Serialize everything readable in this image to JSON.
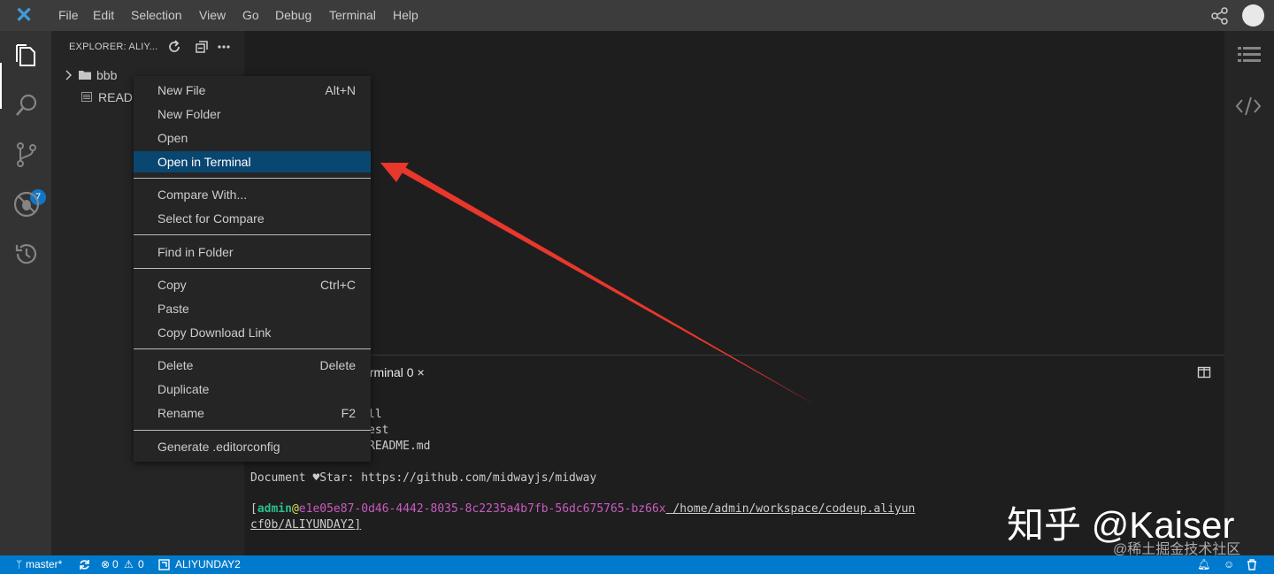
{
  "titlebar": {
    "menu": [
      "File",
      "Edit",
      "Selection",
      "View",
      "Go",
      "Debug",
      "Terminal",
      "Help"
    ]
  },
  "activitybar": {
    "icons": [
      "files-icon",
      "search-icon",
      "source-control-icon",
      "debug-icon",
      "history-icon"
    ],
    "scm_badge": "7"
  },
  "explorer": {
    "title": "EXPLORER: ALIY...",
    "items": [
      {
        "label": "bbb",
        "icon": "folder-icon"
      },
      {
        "label": "READM",
        "icon": "markdown-file-icon"
      }
    ]
  },
  "context_menu": {
    "groups": [
      [
        {
          "label": "New File",
          "shortcut": "Alt+N"
        },
        {
          "label": "New Folder",
          "shortcut": ""
        },
        {
          "label": "Open",
          "shortcut": ""
        },
        {
          "label": "Open in Terminal",
          "shortcut": "",
          "highlighted": true
        }
      ],
      [
        {
          "label": "Compare With...",
          "shortcut": ""
        },
        {
          "label": "Select for Compare",
          "shortcut": ""
        }
      ],
      [
        {
          "label": "Find in Folder",
          "shortcut": ""
        }
      ],
      [
        {
          "label": "Copy",
          "shortcut": "Ctrl+C"
        },
        {
          "label": "Paste",
          "shortcut": ""
        },
        {
          "label": "Copy Download Link",
          "shortcut": ""
        }
      ],
      [
        {
          "label": "Delete",
          "shortcut": "Delete"
        },
        {
          "label": "Duplicate",
          "shortcut": ""
        },
        {
          "label": "Rename",
          "shortcut": "F2"
        }
      ],
      [
        {
          "label": "Generate .editorconfig",
          "shortcut": ""
        }
      ]
    ]
  },
  "panel": {
    "tab": "erminal 0 ×",
    "lines": {
      "l1": "ll",
      "l2": "est",
      "l3": "README.md",
      "l4": "Document ♥Star: https://github.com/midwayjs/midway",
      "prompt_bracket_open": "[",
      "prompt_user": "admin",
      "prompt_at": "@",
      "prompt_host": "e1e05e87-0d46-4442-8035-8c2235a4b7fb-56dc675765-bz66x",
      "prompt_path": " /home/admin/workspace/codeup.aliyun",
      "l6": "cf0b/ALIYUNDAY2]"
    }
  },
  "statusbar": {
    "branch": "master*",
    "errors": "0",
    "warnings": "0",
    "workspace": "ALIYUNDAY2"
  },
  "watermark": {
    "main": "知乎 @Kaiser",
    "sub": "@稀土掘金技术社区"
  },
  "colors": {
    "accent": "#007acc",
    "highlight": "#094771",
    "arrow": "#e8372c",
    "prompt_user": "#2bbd8d",
    "prompt_host": "#c95cc0"
  }
}
